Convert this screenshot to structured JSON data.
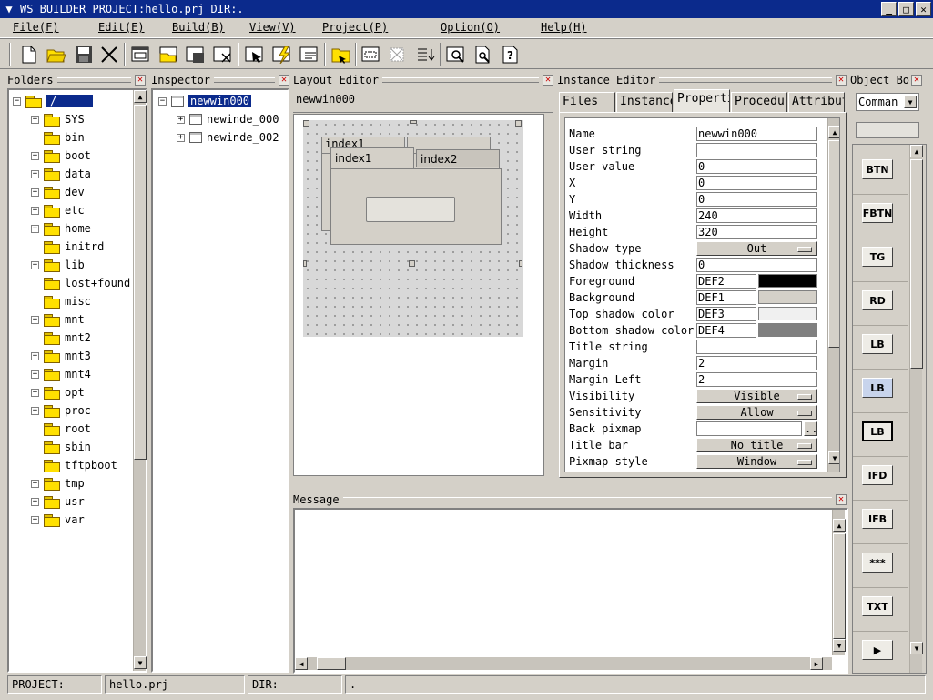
{
  "window": {
    "title": "WS BUILDER PROJECT:hello.prj DIR:.",
    "controls": [
      "minimize-icon",
      "maximize-icon",
      "close-icon"
    ]
  },
  "menu": [
    "File(F)",
    "Edit(E)",
    "Build(B)",
    "View(V)",
    "Project(P)",
    "Option(O)",
    "Help(H)"
  ],
  "toolbar": [
    "new-file-icon",
    "open-folder-icon",
    "save-icon",
    "cut-icon",
    "new-window-icon",
    "open-window-icon",
    "save-window-icon",
    "delete-window-icon",
    "select-icon",
    "build-icon",
    "edit-icon",
    "folder-icon",
    "grid-icon",
    "align-icon",
    "order-icon",
    "preview-icon",
    "search-icon",
    "help-icon"
  ],
  "folders": {
    "title": "Folders",
    "root": "/",
    "items": [
      {
        "name": "SYS",
        "expandable": true
      },
      {
        "name": "bin",
        "expandable": false
      },
      {
        "name": "boot",
        "expandable": true
      },
      {
        "name": "data",
        "expandable": true
      },
      {
        "name": "dev",
        "expandable": true
      },
      {
        "name": "etc",
        "expandable": true
      },
      {
        "name": "home",
        "expandable": true
      },
      {
        "name": "initrd",
        "expandable": false
      },
      {
        "name": "lib",
        "expandable": true
      },
      {
        "name": "lost+found",
        "expandable": false
      },
      {
        "name": "misc",
        "expandable": false
      },
      {
        "name": "mnt",
        "expandable": true
      },
      {
        "name": "mnt2",
        "expandable": false
      },
      {
        "name": "mnt3",
        "expandable": true
      },
      {
        "name": "mnt4",
        "expandable": true
      },
      {
        "name": "opt",
        "expandable": true
      },
      {
        "name": "proc",
        "expandable": true
      },
      {
        "name": "root",
        "expandable": false
      },
      {
        "name": "sbin",
        "expandable": false
      },
      {
        "name": "tftpboot",
        "expandable": false
      },
      {
        "name": "tmp",
        "expandable": true
      },
      {
        "name": "usr",
        "expandable": true
      },
      {
        "name": "var",
        "expandable": true
      }
    ]
  },
  "inspector": {
    "title": "Inspector",
    "root": "newwin000",
    "children": [
      "newinde_000",
      "newinde_002"
    ]
  },
  "layout_editor": {
    "title": "Layout Editor",
    "window_name": "newwin000",
    "tabs_back": [
      "index1"
    ],
    "tabs_front": [
      "index1",
      "index2"
    ]
  },
  "instance_editor": {
    "title": "Instance Editor",
    "tabs": [
      "Files",
      "Instance",
      "Properti",
      "Procedur",
      "Attribut"
    ],
    "active_tab": "Properti",
    "properties": [
      {
        "label": "Name",
        "value": "newwin000",
        "kind": "text"
      },
      {
        "label": "User string",
        "value": "",
        "kind": "text"
      },
      {
        "label": "User value",
        "value": "0",
        "kind": "text"
      },
      {
        "label": "X",
        "value": "0",
        "kind": "text"
      },
      {
        "label": "Y",
        "value": "0",
        "kind": "text"
      },
      {
        "label": "Width",
        "value": "240",
        "kind": "text"
      },
      {
        "label": "Height",
        "value": "320",
        "kind": "text"
      },
      {
        "label": "Shadow type",
        "value": "Out",
        "kind": "select"
      },
      {
        "label": "Shadow thickness",
        "value": "0",
        "kind": "text"
      },
      {
        "label": "Foreground",
        "value": "DEF2",
        "kind": "color",
        "color": "#000000"
      },
      {
        "label": "Background",
        "value": "DEF1",
        "kind": "color",
        "color": "#d4d0c8"
      },
      {
        "label": "Top shadow color",
        "value": "DEF3",
        "kind": "color",
        "color": "#f0f0f0"
      },
      {
        "label": "Bottom shadow color",
        "value": "DEF4",
        "kind": "color",
        "color": "#808080"
      },
      {
        "label": "Title string",
        "value": "",
        "kind": "text"
      },
      {
        "label": "Margin",
        "value": "2",
        "kind": "text"
      },
      {
        "label": "Margin Left",
        "value": "2",
        "kind": "text"
      },
      {
        "label": "Visibility",
        "value": "Visible",
        "kind": "select"
      },
      {
        "label": "Sensitivity",
        "value": "Allow",
        "kind": "select"
      },
      {
        "label": "Back pixmap",
        "value": "",
        "kind": "file",
        "button": ".."
      },
      {
        "label": "Title bar",
        "value": "No title",
        "kind": "select"
      },
      {
        "label": "Pixmap style",
        "value": "Window",
        "kind": "select"
      }
    ]
  },
  "object_box": {
    "title": "Object Bo",
    "combo_value": "Comman",
    "items": [
      "BTN",
      "FBTN",
      "TG",
      "RD",
      "LB",
      "LB",
      "LB",
      "IFD",
      "IFB",
      "***",
      "TXT",
      "▶"
    ]
  },
  "message": {
    "title": "Message"
  },
  "status": {
    "project_label": "PROJECT:",
    "project_value": "hello.prj",
    "dir_label": "DIR:",
    "dir_value": "."
  }
}
